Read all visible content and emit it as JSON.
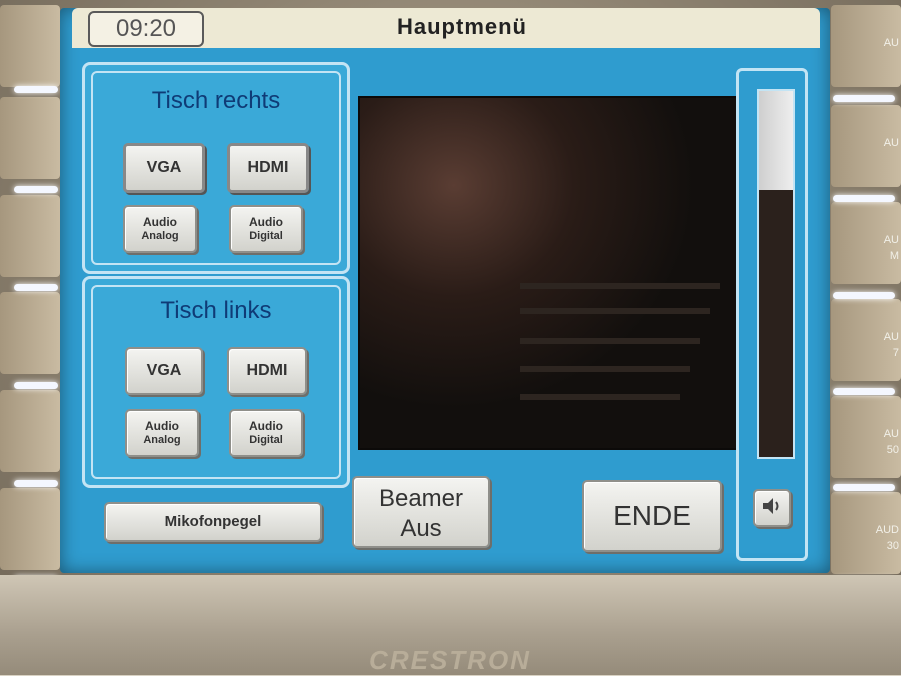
{
  "screen": {
    "time": "09:20",
    "title": "Hauptmenü"
  },
  "groups": [
    {
      "title": "Tisch rechts",
      "vga": "VGA",
      "hdmi": "HDMI",
      "audio_analog": {
        "line1": "Audio",
        "line2": "Analog"
      },
      "audio_digital": {
        "line1": "Audio",
        "line2": "Digital"
      }
    },
    {
      "title": "Tisch links",
      "vga": "VGA",
      "hdmi": "HDMI",
      "audio_analog": {
        "line1": "Audio",
        "line2": "Analog"
      },
      "audio_digital": {
        "line1": "Audio",
        "line2": "Digital"
      }
    }
  ],
  "buttons": {
    "mikrofon": "Mikofonpegel",
    "beamer": {
      "line1": "Beamer",
      "line2": "Aus"
    },
    "ende": "ENDE"
  },
  "volume": {
    "level": 0.27,
    "icon": "speaker-icon"
  },
  "side_buttons_right": [
    {
      "label1": "AU",
      "label2": ""
    },
    {
      "label1": "AU",
      "label2": ""
    },
    {
      "label1": "AU",
      "label2": "M"
    },
    {
      "label1": "AU",
      "label2": "7"
    },
    {
      "label1": "AU",
      "label2": "50"
    },
    {
      "label1": "AUD",
      "label2": "30"
    }
  ],
  "brand": "CRESTRON",
  "colors": {
    "screen": "#2f9ccf",
    "group_title": "#0f3b76",
    "title_bar": "#ede9d4"
  }
}
